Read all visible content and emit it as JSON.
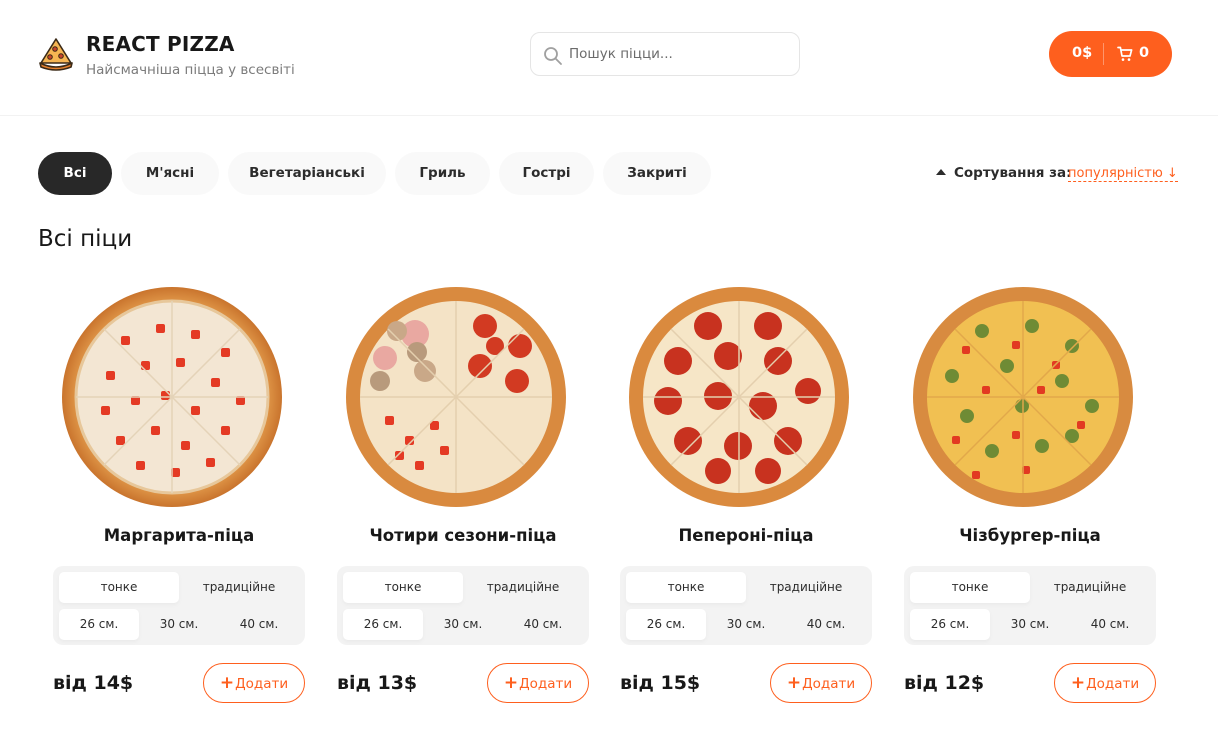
{
  "header": {
    "title": "REACT PIZZA",
    "subtitle": "Найсмачніша піцца у всесвіті",
    "logo_icon": "pizza-slice-icon",
    "search_placeholder": "Пошук піцци...",
    "search_icon": "search-icon",
    "cart_price": "0$",
    "cart_count": "0",
    "cart_icon": "cart-icon"
  },
  "categories": [
    "Всі",
    "М'ясні",
    "Вегетаріанські",
    "Гриль",
    "Гострі",
    "Закриті"
  ],
  "active_category": "Всі",
  "sort": {
    "label": "Сортування за:",
    "value": "популярністю ↓"
  },
  "section_title": "Всі піци",
  "colors": {
    "accent": "#fe5f1e",
    "dark": "#282828"
  },
  "pizzas": [
    {
      "title": "Маргарита-піца",
      "types": [
        "тонке",
        "традиційне"
      ],
      "sizes": [
        "26 см.",
        "30 см.",
        "40 см."
      ],
      "price": "від 14$",
      "add_label": "Додати",
      "add_icon": "plus-icon"
    },
    {
      "title": "Чотири сезони-піца",
      "types": [
        "тонке",
        "традиційне"
      ],
      "sizes": [
        "26 см.",
        "30 см.",
        "40 см."
      ],
      "price": "від 13$",
      "add_label": "Додати",
      "add_icon": "plus-icon"
    },
    {
      "title": "Пепероні-піца",
      "types": [
        "тонке",
        "традиційне"
      ],
      "sizes": [
        "26 см.",
        "30 см.",
        "40 см."
      ],
      "price": "від 15$",
      "add_label": "Додати",
      "add_icon": "plus-icon"
    },
    {
      "title": "Чізбургер-піца",
      "types": [
        "тонке",
        "традиційне"
      ],
      "sizes": [
        "26 см.",
        "30 см.",
        "40 см."
      ],
      "price": "від 12$",
      "add_label": "Додати",
      "add_icon": "plus-icon"
    }
  ]
}
